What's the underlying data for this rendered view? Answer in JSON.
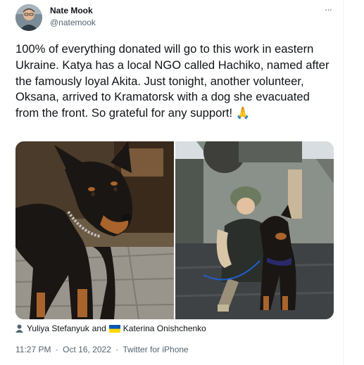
{
  "author": {
    "display_name": "Nate Mook",
    "handle": "@natemook",
    "avatar_icon": "person-avatar"
  },
  "more_icon": "more-horizontal-icon",
  "more_label": "···",
  "tweet": {
    "text": "100% of everything donated will go to this work in eastern Ukraine. Katya has a local NGO called Hachiko, named after the famously loyal Akita. Just tonight, another volunteer, Oksana, arrived to Kramatorsk with a dog she evacuated from the front. So grateful for any support! 🙏"
  },
  "media": [
    {
      "description_icon": "photo-dog-doberman"
    },
    {
      "description_icon": "photo-volunteer-with-dog"
    }
  ],
  "tags": {
    "person_icon": "person-icon",
    "user1": "Yuliya Stefanyuk",
    "conjunction": "and",
    "flag_icon": "ukraine-flag-icon",
    "user2": "Katerina Onishchenko"
  },
  "meta": {
    "time": "11:27 PM",
    "separator": "·",
    "date": "Oct 16, 2022",
    "source": "Twitter for iPhone"
  },
  "colors": {
    "text": "#0f1419",
    "secondary": "#536471",
    "border": "#eff3f4",
    "flag_blue": "#0057b7",
    "flag_yellow": "#ffd700"
  }
}
